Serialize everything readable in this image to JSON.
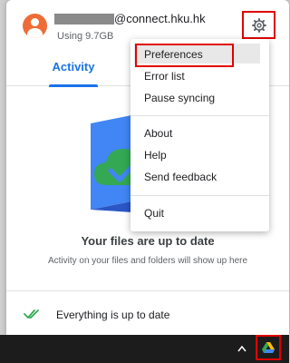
{
  "header": {
    "email_suffix": "@connect.hku.hk",
    "storage_usage": "Using 9.7GB",
    "avatar_color": "#ef6c36"
  },
  "tabs": [
    {
      "label": "Activity",
      "active": true
    }
  ],
  "menu": {
    "items": [
      {
        "label": "Preferences",
        "highlighted": true
      },
      {
        "label": "Error list"
      },
      {
        "label": "Pause syncing"
      },
      {
        "label": "About"
      },
      {
        "label": "Help"
      },
      {
        "label": "Send feedback"
      },
      {
        "label": "Quit"
      }
    ]
  },
  "status": {
    "title": "Your files are up to date",
    "subtitle": "Activity on your files and folders will show up here"
  },
  "bottom_bar": {
    "text": "Everything is up to date"
  },
  "colors": {
    "accent": "#1a73e8",
    "annotation_box": "#e00000",
    "folder_blue": "#4285f4",
    "cloud_green": "#34a853"
  },
  "icons": {
    "settings": "gear-icon",
    "status_check": "double-check-icon",
    "tray_caret": "caret-up-icon",
    "tray_drive": "google-drive-icon"
  }
}
